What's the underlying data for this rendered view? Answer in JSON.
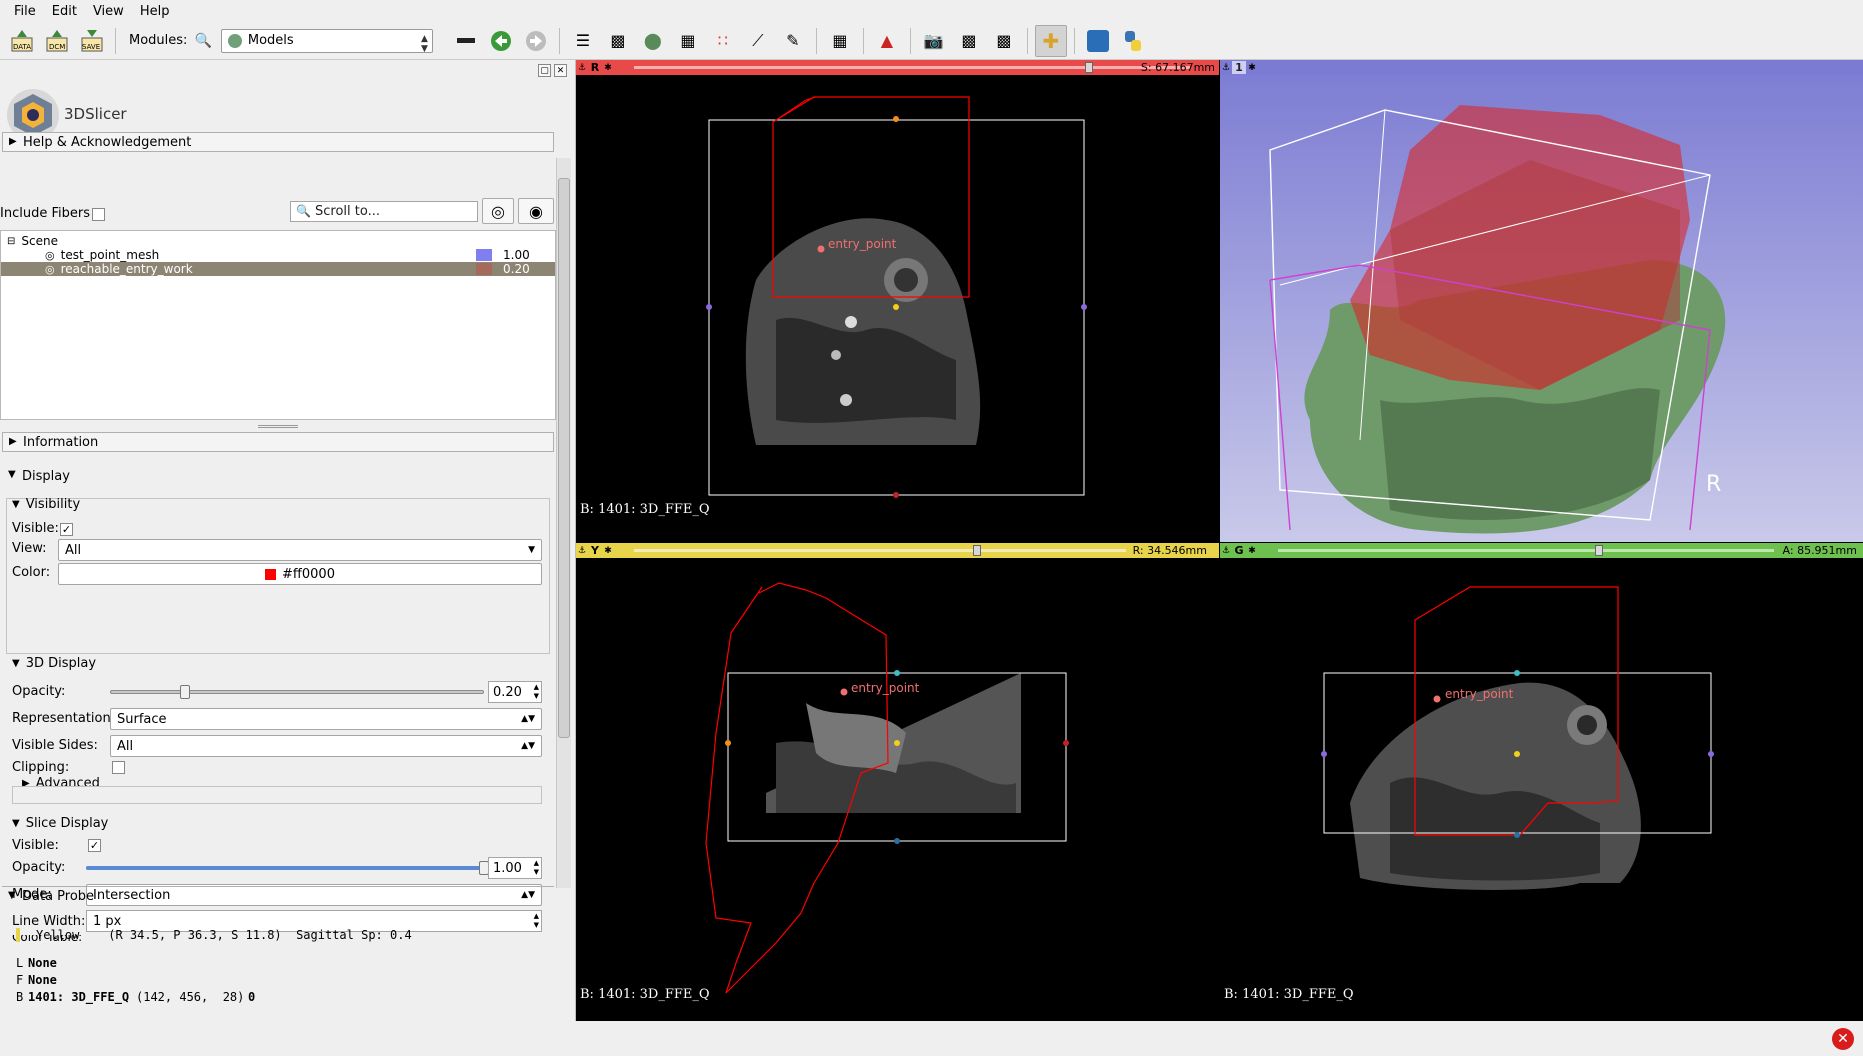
{
  "menu": [
    "File",
    "Edit",
    "View",
    "Help"
  ],
  "toolbar": {
    "data_label": "DATA",
    "dcm_label": "DCM",
    "save_label": "SAVE",
    "modules_label": "Modules:",
    "module_selected": "Models"
  },
  "app": {
    "logo_text": "3DSlicer"
  },
  "sections": {
    "help": "Help & Acknowledgement",
    "include_fibers": "Include Fibers",
    "scroll_placeholder": "Scroll to...",
    "information": "Information",
    "display": "Display",
    "data_probe": "Data Probe"
  },
  "scene": {
    "root": "Scene",
    "items": [
      {
        "name": "test_point_mesh",
        "opacity": "1.00",
        "color": "#7f7ff0"
      },
      {
        "name": "reachable_entry_work",
        "opacity": "0.20",
        "color": "#ff0000"
      }
    ]
  },
  "display": {
    "visibility_header": "Visibility",
    "visible_label": "Visible:",
    "view_label": "View:",
    "view_value": "All",
    "color_label": "Color:",
    "color_value": "#ff0000",
    "display3d_header": "3D Display",
    "opacity_label": "Opacity:",
    "opacity_value": "0.20",
    "opacity_fraction": 0.2,
    "representation_label": "Representation:",
    "representation_value": "Surface",
    "visible_sides_label": "Visible Sides:",
    "visible_sides_value": "All",
    "clipping_label": "Clipping:",
    "advanced_label": "Advanced",
    "slice_header": "Slice Display",
    "slice_visible_label": "Visible:",
    "slice_opacity_label": "Opacity:",
    "slice_opacity_value": "1.00",
    "slice_opacity_fraction": 1.0,
    "mode_label": "Mode:",
    "mode_value": "Intersection",
    "line_width_label": "Line Width:",
    "line_width_value": "1 px",
    "color_table_label": "Color Table:"
  },
  "probe": {
    "line1": "Yellow    (R 34.5, P 36.3, S 11.8)  Sagittal Sp: 0.4",
    "l_key": "L",
    "l_val": "None",
    "f_key": "F",
    "f_val": "None",
    "b_key": "B",
    "b_name": "1401: 3D_FFE_Q",
    "b_coords": "(142, 456,  28)",
    "b_val": "0"
  },
  "views": {
    "red": {
      "letter": "R",
      "value": "S: 67.167mm",
      "label": "B: 1401: 3D_FFE_Q",
      "slider": 0.82,
      "color": "#e84a4a"
    },
    "three_d": {
      "number": "1",
      "orientation": "R",
      "color": "#7b7bd3"
    },
    "yellow": {
      "letter": "Y",
      "value": "R: 34.546mm",
      "label": "B: 1401: 3D_FFE_Q",
      "slider": 0.7,
      "color": "#e8d44a"
    },
    "green": {
      "letter": "G",
      "value": "A: 85.951mm",
      "label": "B: 1401: 3D_FFE_Q",
      "slider": 0.65,
      "color": "#6ec04f"
    }
  },
  "annotations": {
    "entry_point": "entry_point"
  }
}
